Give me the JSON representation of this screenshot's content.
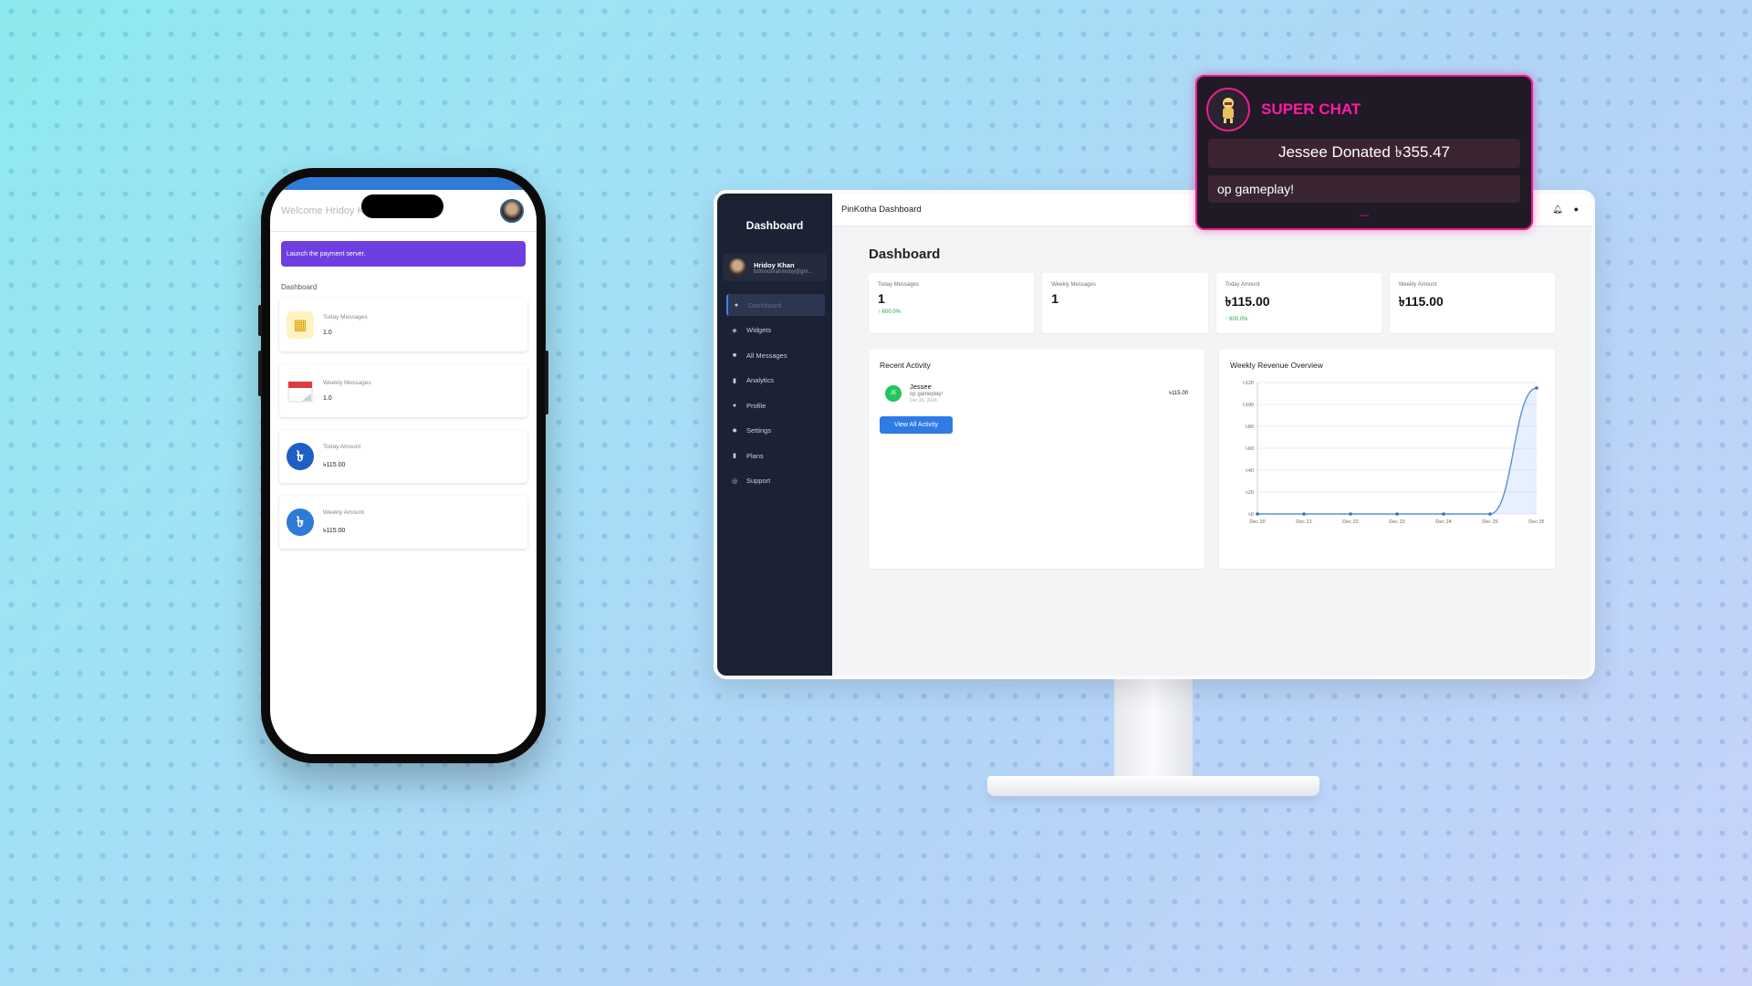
{
  "colors": {
    "accent_blue": "#2f7be6",
    "phone_banner": "#6d3fe0",
    "sidebar_bg": "#1b2233",
    "positive": "#22a34a",
    "superchat_pink": "#e91e8c"
  },
  "phone": {
    "welcome": "Welcome Hridoy Kh",
    "banner": "Launch the payment server.",
    "section_title": "Dashboard",
    "cards": [
      {
        "label": "Today Messages",
        "value": "1.0",
        "icon": "calendar-icon"
      },
      {
        "label": "Weekly Messages",
        "value": "1.0",
        "icon": "calendar-week-icon"
      },
      {
        "label": "Today Amount",
        "value": "৳115.00",
        "icon": "taka-icon"
      },
      {
        "label": "Weekly Amount",
        "value": "৳115.00",
        "icon": "taka-icon"
      }
    ]
  },
  "desktop": {
    "sidebar": {
      "title": "Dashboard",
      "user_name": "Hridoy Khan",
      "user_email": "bdmoobrahmdoy@gm...",
      "items": [
        {
          "label": "Dashboard",
          "icon": "dashboard-icon"
        },
        {
          "label": "Widgets",
          "icon": "widgets-icon"
        },
        {
          "label": "All Messages",
          "icon": "message-icon"
        },
        {
          "label": "Analytics",
          "icon": "chart-icon"
        },
        {
          "label": "Profile",
          "icon": "user-icon"
        },
        {
          "label": "Settings",
          "icon": "gear-icon"
        },
        {
          "label": "Plans",
          "icon": "document-icon"
        },
        {
          "label": "Support",
          "icon": "support-icon"
        }
      ]
    },
    "topbar": {
      "title": "PinKotha Dashboard",
      "bell_icon": "bell-icon",
      "user_icon": "user-icon"
    },
    "page_title": "Dashboard",
    "stats": [
      {
        "label": "Today Messages",
        "value": "1",
        "change": "600.0%"
      },
      {
        "label": "Weekly Messages",
        "value": "1",
        "change": ""
      },
      {
        "label": "Today Amount",
        "value": "৳115.00",
        "change": "600.0%"
      },
      {
        "label": "Weekly Amount",
        "value": "৳115.00",
        "change": ""
      }
    ],
    "recent_activity": {
      "title": "Recent Activity",
      "items": [
        {
          "initials": "JE",
          "name": "Jessee",
          "message": "op gameplay!",
          "date": "Dec 26, 2024",
          "amount": "৳115.00"
        }
      ],
      "button": "View All Activity"
    }
  },
  "superchat": {
    "title": "SUPER CHAT",
    "donation": "Jessee Donated ৳355.47",
    "message": "op gameplay!",
    "avatar_icon": "character-avatar-icon"
  },
  "chart_data": {
    "type": "area",
    "title": "Weekly Revenue Overview",
    "categories": [
      "Dec 20",
      "Dec 21",
      "Dec 22",
      "Dec 23",
      "Dec 24",
      "Dec 25",
      "Dec 26"
    ],
    "series": [
      {
        "values": [
          0,
          0,
          0,
          0,
          0,
          0,
          115
        ]
      }
    ],
    "y_ticks": [
      "৳0",
      "৳20",
      "৳40",
      "৳60",
      "৳80",
      "৳100",
      "৳120"
    ],
    "ylim": [
      0,
      120
    ],
    "grid": true
  }
}
